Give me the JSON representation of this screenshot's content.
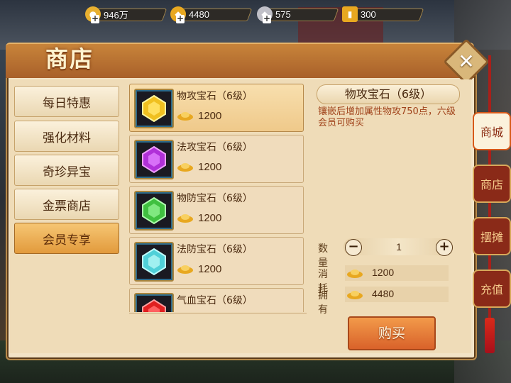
{
  "resources": [
    {
      "icon": "gold-coin-icon",
      "value": "946万",
      "color": "#e8b030"
    },
    {
      "icon": "gold-ingot-icon",
      "value": "4480",
      "color": "#e8a820"
    },
    {
      "icon": "silver-ingot-icon",
      "value": "575",
      "color": "#c0c0c8"
    },
    {
      "icon": "gold-ticket-icon",
      "value": "300",
      "color": "#e8a820"
    }
  ],
  "shop": {
    "title": "商店",
    "categories": [
      {
        "label": "每日特惠",
        "active": false
      },
      {
        "label": "强化材料",
        "active": false
      },
      {
        "label": "奇珍异宝",
        "active": false
      },
      {
        "label": "金票商店",
        "active": false
      },
      {
        "label": "会员专享",
        "active": true
      }
    ],
    "items": [
      {
        "name": "物攻宝石（6级）",
        "price": "1200",
        "gem_color": "#f0c020",
        "selected": true
      },
      {
        "name": "法攻宝石（6级）",
        "price": "1200",
        "gem_color": "#b030d8",
        "selected": false
      },
      {
        "name": "物防宝石（6级）",
        "price": "1200",
        "gem_color": "#40c040",
        "selected": false
      },
      {
        "name": "法防宝石（6级）",
        "price": "1200",
        "gem_color": "#50d0d8",
        "selected": false
      },
      {
        "name": "气血宝石（6级）",
        "price": "",
        "gem_color": "#e02020",
        "selected": false
      }
    ]
  },
  "detail": {
    "title": "物攻宝石（6级）",
    "description": "镶嵌后增加属性物攻750点，六级会员可购买",
    "quantity_label": "数量",
    "quantity": "1",
    "minus": "−",
    "plus": "+",
    "cost_label": "消耗",
    "cost": "1200",
    "own_label": "拥有",
    "own": "4480",
    "buy_label": "购买"
  },
  "side_tabs": [
    {
      "label": "商城",
      "active": true
    },
    {
      "label": "商店",
      "active": false
    },
    {
      "label": "摆摊",
      "active": false
    },
    {
      "label": "充值",
      "active": false
    }
  ],
  "close_glyph": "✕"
}
